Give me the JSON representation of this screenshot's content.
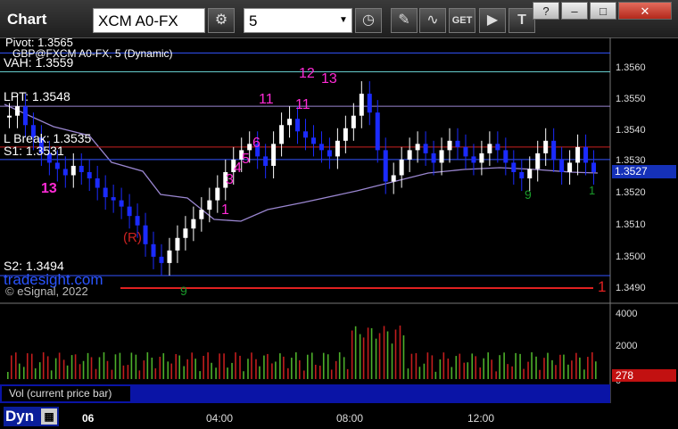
{
  "window": {
    "title": "Chart",
    "symbol": "XCM A0-FX",
    "interval": "5",
    "controls": [
      "?",
      "–",
      "□",
      "✕"
    ]
  },
  "toolbar_icons": [
    "settings-icon",
    "clock-icon",
    "pencil-icon",
    "indicator-icon",
    "get-icon",
    "play-icon",
    "text-icon"
  ],
  "chart_data": {
    "type": "candlestick",
    "instrument_label": "GBP@FXCM A0-FX, 5 (Dynamic)",
    "y_ticks": [
      "1.3560",
      "1.3550",
      "1.3540",
      "1.3530",
      "1.3520",
      "1.3510",
      "1.3500",
      "1.3490"
    ],
    "y_range": [
      1.3485,
      1.3565
    ],
    "last_price": "1.3527",
    "levels": [
      {
        "name": "Pivot",
        "label": "Pivot: 1.3565",
        "value": 1.3565
      },
      {
        "name": "VAH",
        "label": "VAH: 1.3559",
        "value": 1.3559
      },
      {
        "name": "LPT",
        "label": "LPT: 1.3548",
        "value": 1.3548
      },
      {
        "name": "LBreak",
        "label": "L Break: 1.3535",
        "value": 1.3535
      },
      {
        "name": "S1",
        "label": "S1: 1.3531",
        "value": 1.3531
      },
      {
        "name": "S2",
        "label": "S2: 1.3494",
        "value": 1.3494
      }
    ],
    "annotations": [
      "13",
      "10",
      "11",
      "12",
      "13",
      "1",
      "3",
      "4",
      "5",
      "6",
      "(R)",
      "9",
      "9",
      "1"
    ],
    "time_labels": [
      "06",
      "04:00",
      "08:00",
      "12:00"
    ],
    "volume": {
      "label": "Vol (current price bar)",
      "ticks": [
        "4000",
        "2000",
        "0"
      ],
      "last_value": "278"
    },
    "watermark": "tradesight.com",
    "copyright": "© eSignal, 2022",
    "price_marker": "1"
  },
  "footer": {
    "mode": "Dyn"
  },
  "colors": {
    "up": "#ffffff",
    "down": "#1b2bff",
    "level": "#cc2222",
    "magenta": "#ff2bd6",
    "green": "#1a9a2a"
  }
}
